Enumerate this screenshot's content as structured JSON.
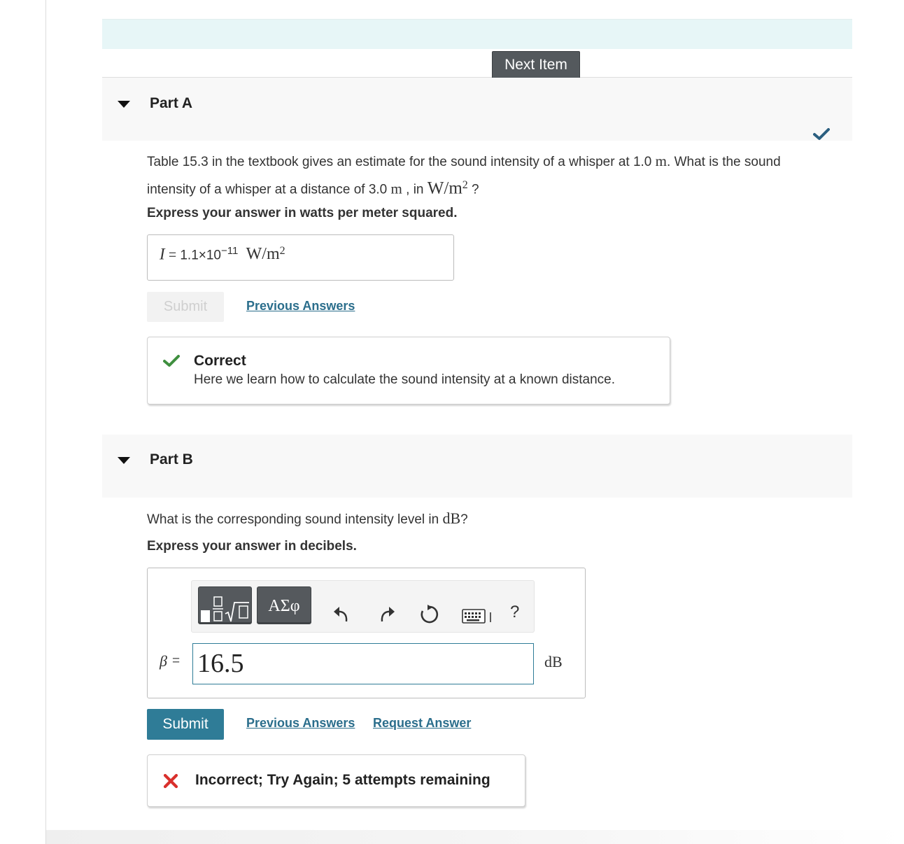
{
  "navigation": {
    "next_item_label": "Next Item"
  },
  "part_a": {
    "title": "Part A",
    "question_line1_text": "Table 15.3 in the textbook gives an estimate for the sound intensity of a whisper at 1.0 ",
    "question_line1_unit": "m",
    "question_line1_tail": ". What is the sound",
    "question_line2_text": "intensity of a whisper at a distance of 3.0 ",
    "question_line2_unit": "m",
    "question_line2_mid": " , in ",
    "question_unit_base": "W/m",
    "question_unit_exp": "2",
    "question_line2_tail": " ?",
    "instruction": "Express your answer in watts per meter squared.",
    "answer_symbol": "I",
    "answer_equals": "=",
    "answer_mantissa": "1.1×10",
    "answer_exponent": "−11",
    "answer_unit_base": "W/m",
    "answer_unit_exp": "2",
    "submit_label": "Submit",
    "previous_answers_label": "Previous Answers",
    "feedback_title": "Correct",
    "feedback_message": "Here we learn how to calculate the sound intensity at a known distance.",
    "status": "correct"
  },
  "part_b": {
    "title": "Part B",
    "question_text": "What is the corresponding sound intensity level in ",
    "question_unit": "dB",
    "question_tail": "?",
    "instruction": "Express your answer in decibels.",
    "toolbar": {
      "greek_label": "ΑΣφ",
      "help_label": "?"
    },
    "answer_symbol": "β",
    "answer_equals": "=",
    "answer_value": "16.5",
    "answer_unit": "dB",
    "submit_label": "Submit",
    "previous_answers_label": "Previous Answers",
    "request_answer_label": "Request Answer",
    "feedback_message": "Incorrect; Try Again; 5 attempts remaining",
    "status": "incorrect"
  },
  "colors": {
    "banner": "#e7f6f7",
    "accent": "#2f7c97",
    "correct": "#3f8f3f",
    "incorrect": "#d9302c"
  }
}
